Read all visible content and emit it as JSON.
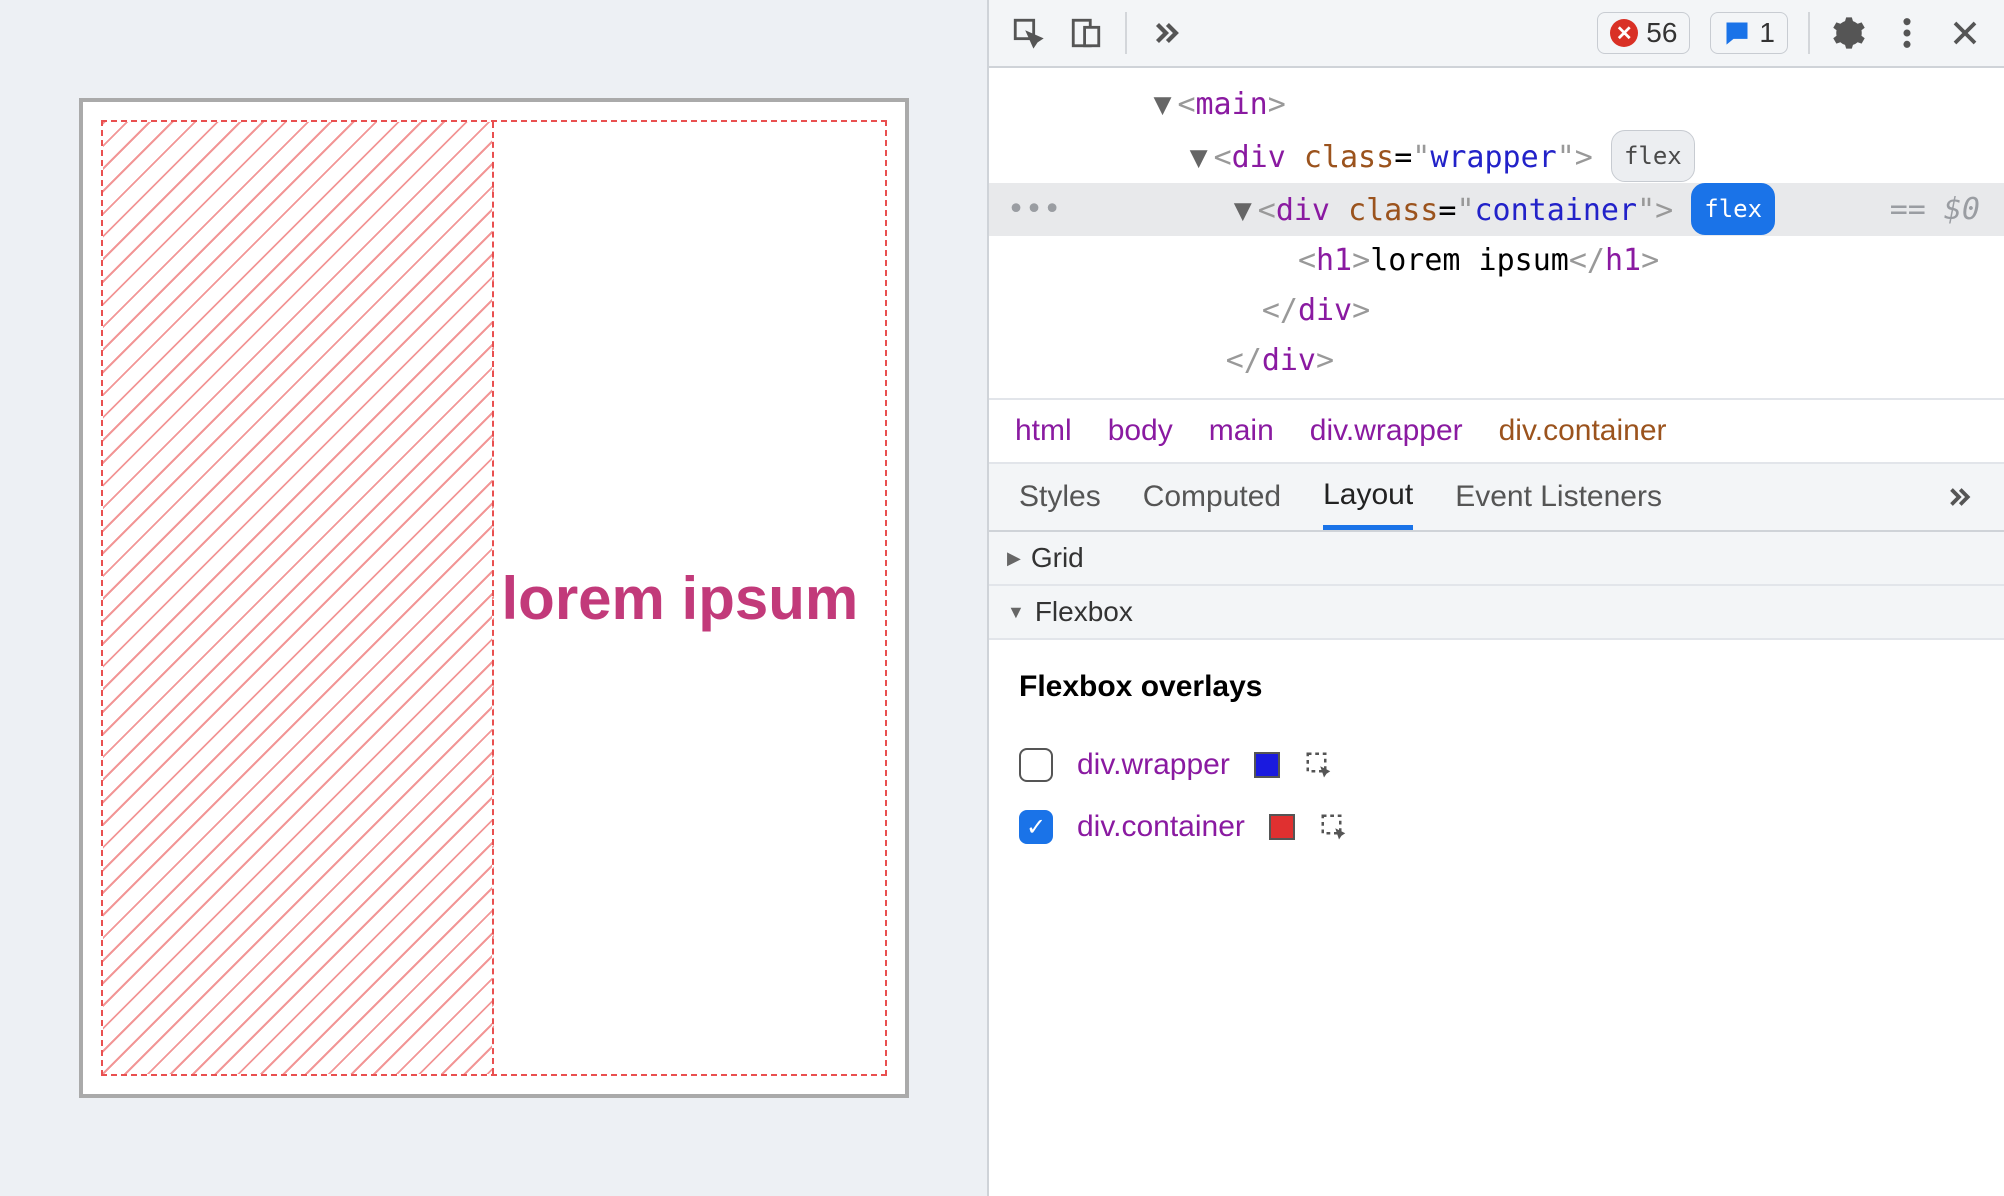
{
  "viewport": {
    "heading": "lorem ipsum"
  },
  "toolbar": {
    "errors_count": "56",
    "issues_count": "1"
  },
  "elements": {
    "line_main_open": "<main>",
    "line_wrapper_open": "<div class=\"wrapper\">",
    "wrapper_flex_pill": "flex",
    "line_container_open": "<div class=\"container\">",
    "container_flex_pill": "flex",
    "selected_suffix": "== $0",
    "line_h1": "<h1>lorem ipsum</h1>",
    "line_div_close1": "</div>",
    "line_div_close2": "</div>"
  },
  "breadcrumb": {
    "items": [
      "html",
      "body",
      "main",
      "div.wrapper",
      "div.container"
    ]
  },
  "subtabs": {
    "styles": "Styles",
    "computed": "Computed",
    "layout": "Layout",
    "listeners": "Event Listeners"
  },
  "layout_panel": {
    "grid_title": "Grid",
    "flexbox_title": "Flexbox",
    "overlays_heading": "Flexbox overlays",
    "overlays": [
      {
        "label": "div.wrapper",
        "checked": false,
        "swatch": "blue"
      },
      {
        "label": "div.container",
        "checked": true,
        "swatch": "red"
      }
    ]
  }
}
